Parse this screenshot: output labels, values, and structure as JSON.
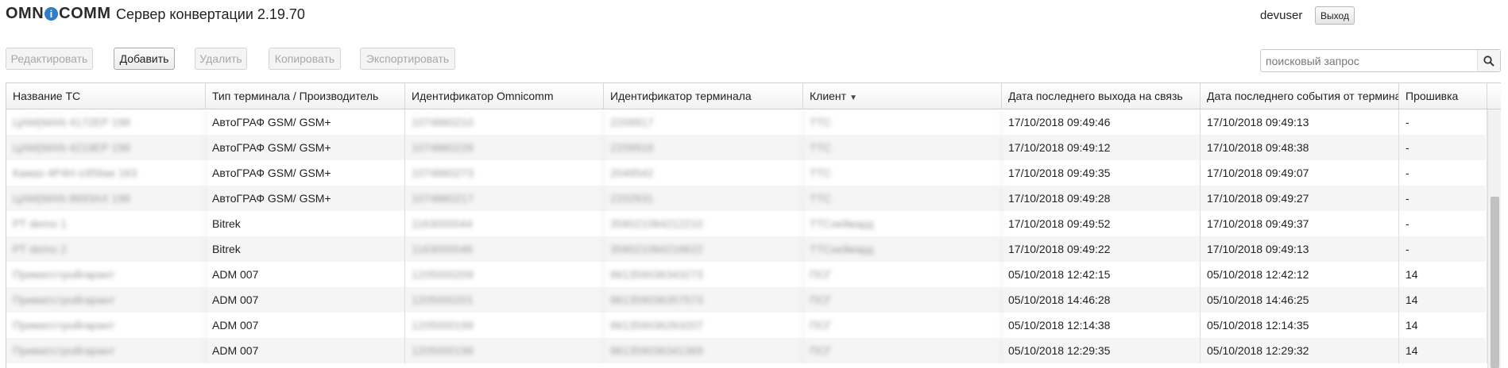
{
  "header": {
    "logo_left": "OMN",
    "logo_i": "i",
    "logo_right": "COMM",
    "title": "Сервер конвертации 2.19.70",
    "user": "devuser",
    "logout_label": "Выход"
  },
  "toolbar": {
    "edit_label": "Редактировать",
    "add_label": "Добавить",
    "delete_label": "Удалить",
    "copy_label": "Копировать",
    "export_label": "Экспортировать"
  },
  "search": {
    "placeholder": "поисковый запрос",
    "value": "",
    "icon": "search-icon"
  },
  "table": {
    "columns": [
      "Название ТС",
      "Тип терминала / Производитель",
      "Идентификатор Omnicomm",
      "Идентификатор терминала",
      "Клиент",
      "Дата последнего выхода на связь",
      "Дата последнего события от терминала",
      "Прошивка"
    ],
    "sort_indicator": "▼",
    "rows": [
      [
        "ЦАМ(MAN 4172EP 198",
        "АвтоГРАФ GSM/ GSM+",
        "1074860210",
        "2209917",
        "ТТС",
        "17/10/2018 09:49:46",
        "17/10/2018 09:49:13",
        "-"
      ],
      [
        "ЦАМ(MAN 4219EP 198",
        "АвтоГРАФ GSM/ GSM+",
        "1074860228",
        "2209916",
        "ТТС",
        "17/10/2018 09:49:12",
        "17/10/2018 09:48:38",
        "-"
      ],
      [
        "Камаз 4Р4Н о359ае 163",
        "АвтоГРАФ GSM/ GSM+",
        "1074860273",
        "2049542",
        "ТТС",
        "17/10/2018 09:49:35",
        "17/10/2018 09:49:07",
        "-"
      ],
      [
        "ЦАМ(MAN 8693АХ 198",
        "АвтоГРАФ GSM/ GSM+",
        "1074860217",
        "2202631",
        "ТТС",
        "17/10/2018 09:49:28",
        "17/10/2018 09:49:27",
        "-"
      ],
      [
        "РТ demo 1",
        "Bitrek",
        "1163000044",
        "358021084212210",
        "ТТСхейвард",
        "17/10/2018 09:49:52",
        "17/10/2018 09:49:37",
        "-"
      ],
      [
        "РТ demo 2",
        "Bitrek",
        "1163000046",
        "358021084218622",
        "ТТСхейвард",
        "17/10/2018 09:49:22",
        "17/10/2018 09:49:13",
        "-"
      ],
      [
        "Приматстройгарант",
        "ADM 007",
        "1205000209",
        "861359036343273",
        "ПСГ",
        "05/10/2018 12:42:15",
        "05/10/2018 12:42:12",
        "14"
      ],
      [
        "Приматстройгарант",
        "ADM 007",
        "1205000201",
        "861359036357573",
        "ПСГ",
        "05/10/2018 14:46:28",
        "05/10/2018 14:46:25",
        "14"
      ],
      [
        "Приматстройгарант",
        "ADM 007",
        "1205000199",
        "861359036263207",
        "ПСГ",
        "05/10/2018 12:14:38",
        "05/10/2018 12:14:35",
        "14"
      ],
      [
        "Приматстройгарант",
        "ADM 007",
        "1205000198",
        "861359036341369",
        "ПСГ",
        "05/10/2018 12:29:35",
        "05/10/2018 12:29:32",
        "14"
      ]
    ]
  }
}
